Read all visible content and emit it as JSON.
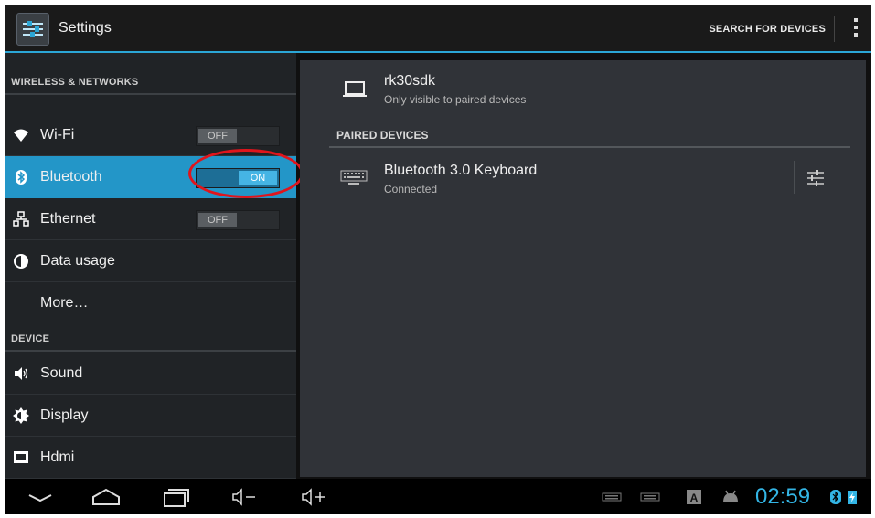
{
  "app": {
    "title": "Settings",
    "search_label": "SEARCH FOR DEVICES"
  },
  "sidebar": {
    "wireless_header": "WIRELESS & NETWORKS",
    "device_header": "DEVICE",
    "items": [
      {
        "label": "Wi-Fi",
        "icon": "wifi-icon",
        "switch": "OFF"
      },
      {
        "label": "Bluetooth",
        "icon": "bluetooth-icon",
        "switch": "ON"
      },
      {
        "label": "Ethernet",
        "icon": "ethernet-icon",
        "switch": "OFF"
      },
      {
        "label": "Data usage",
        "icon": "data-usage-icon"
      },
      {
        "label": "More…"
      },
      {
        "label": "Sound",
        "icon": "speaker-icon"
      },
      {
        "label": "Display",
        "icon": "brightness-icon"
      },
      {
        "label": "Hdmi",
        "icon": "hdmi-icon"
      }
    ]
  },
  "bluetooth": {
    "this_device": {
      "name": "rk30sdk",
      "status": "Only visible to paired devices"
    },
    "paired_header": "PAIRED DEVICES",
    "paired": [
      {
        "name": "Bluetooth 3.0 Keyboard",
        "status": "Connected"
      }
    ]
  },
  "statusbar": {
    "time": "02:59"
  },
  "colors": {
    "accent": "#33b5e5",
    "active_row": "#2396c8",
    "highlight_ring": "#e0151c"
  }
}
